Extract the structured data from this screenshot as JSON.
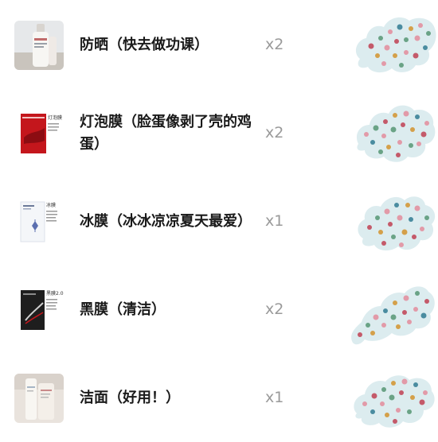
{
  "items": [
    {
      "name": "防晒（快去做功课）",
      "qty": "x2",
      "thumb_icon": "sunscreen-bottle-icon"
    },
    {
      "name": "灯泡膜（脸蛋像剥了壳的鸡蛋）",
      "qty": "x2",
      "thumb_icon": "red-mask-package-icon",
      "pkg_text": "灯泡膜"
    },
    {
      "name": "冰膜（冰冰凉凉夏天最爱）",
      "qty": "x1",
      "thumb_icon": "white-mask-package-icon",
      "pkg_text": "冰膜"
    },
    {
      "name": "黑膜（清洁）",
      "qty": "x2",
      "thumb_icon": "black-mask-package-icon",
      "pkg_text": "黑膜2.0"
    },
    {
      "name": "洁面（好用！）",
      "qty": "x1",
      "thumb_icon": "cleanser-tube-icon"
    }
  ],
  "colors": {
    "text": "#1a1a1a",
    "qty": "#9a9a9a",
    "sticker_bg": "#dcecef"
  },
  "decoration_icon": "polka-dot-sticker-icon"
}
